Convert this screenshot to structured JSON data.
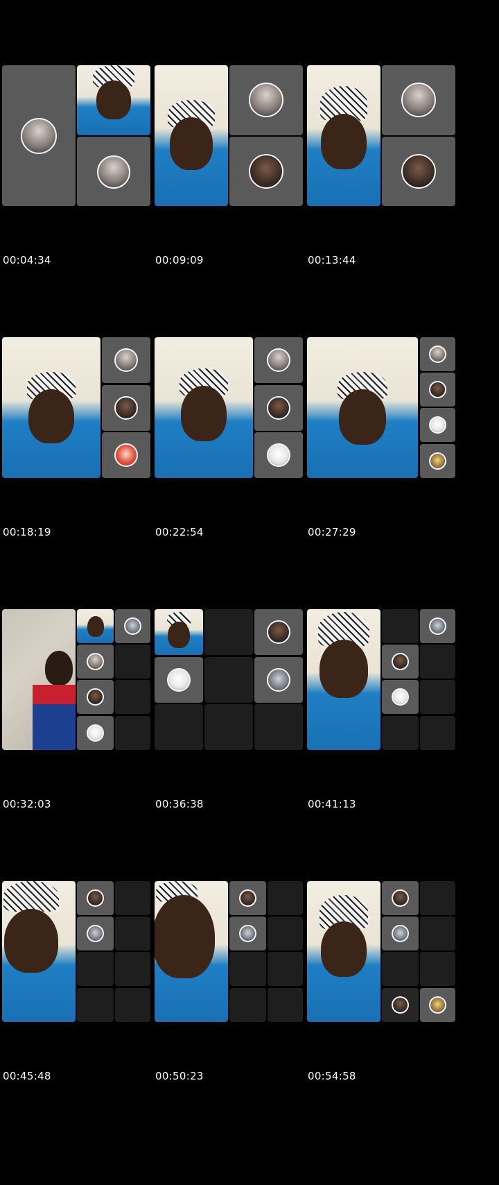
{
  "frames": [
    {
      "timestamp": "00:04:34"
    },
    {
      "timestamp": "00:09:09"
    },
    {
      "timestamp": "00:13:44"
    },
    {
      "timestamp": "00:18:19"
    },
    {
      "timestamp": "00:22:54"
    },
    {
      "timestamp": "00:27:29"
    },
    {
      "timestamp": "00:32:03"
    },
    {
      "timestamp": "00:36:38"
    },
    {
      "timestamp": "00:41:13"
    },
    {
      "timestamp": "00:45:48"
    },
    {
      "timestamp": "00:50:23"
    },
    {
      "timestamp": "00:54:58"
    }
  ],
  "colors": {
    "background": "#000000",
    "tile_gray": "#5a5a5a",
    "tile_dark": "#1e1e1e",
    "jersey_blue": "#1f7fc4",
    "timestamp_text": "#ffffff"
  }
}
